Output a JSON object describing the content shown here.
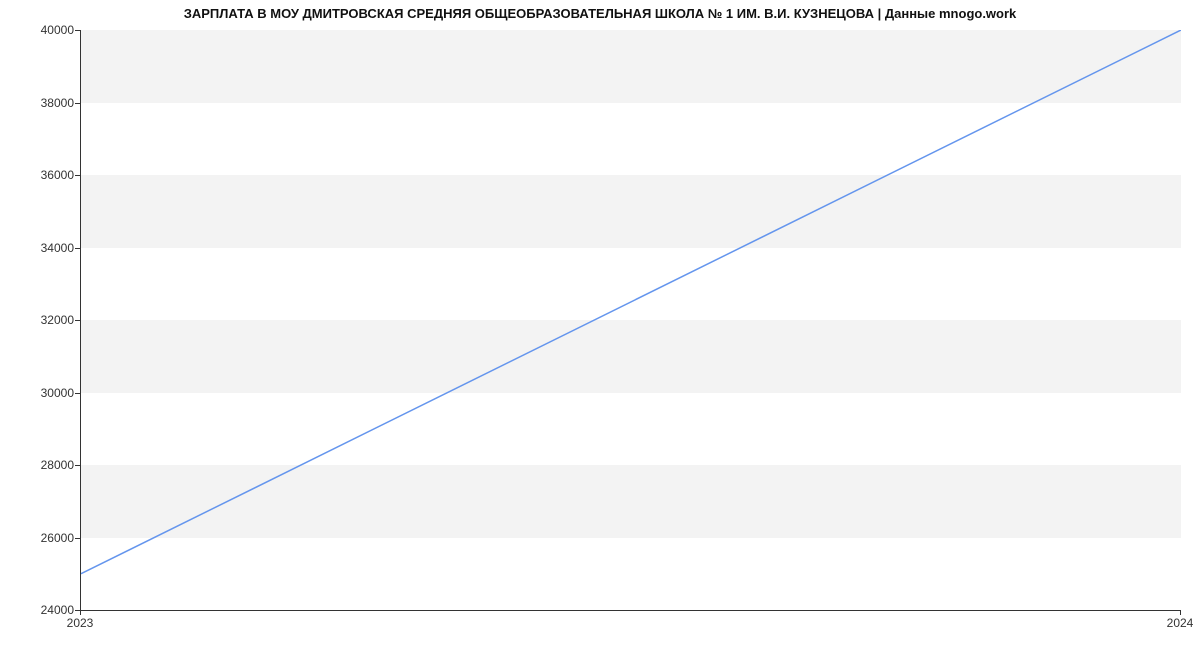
{
  "chart_data": {
    "type": "line",
    "title": "ЗАРПЛАТА В МОУ ДМИТРОВСКАЯ СРЕДНЯЯ ОБЩЕОБРАЗОВАТЕЛЬНАЯ ШКОЛА № 1 ИМ. В.И. КУЗНЕЦОВА | Данные mnogo.work",
    "x": [
      2023,
      2024
    ],
    "values": [
      25000,
      40000
    ],
    "x_tick_labels": [
      "2023",
      "2024"
    ],
    "y_ticks": [
      24000,
      26000,
      28000,
      30000,
      32000,
      34000,
      36000,
      38000,
      40000
    ],
    "ylim": [
      24000,
      40000
    ],
    "xlim": [
      2023,
      2024
    ],
    "xlabel": "",
    "ylabel": "",
    "line_color": "#6495ed",
    "band_color": "#f3f3f3"
  }
}
